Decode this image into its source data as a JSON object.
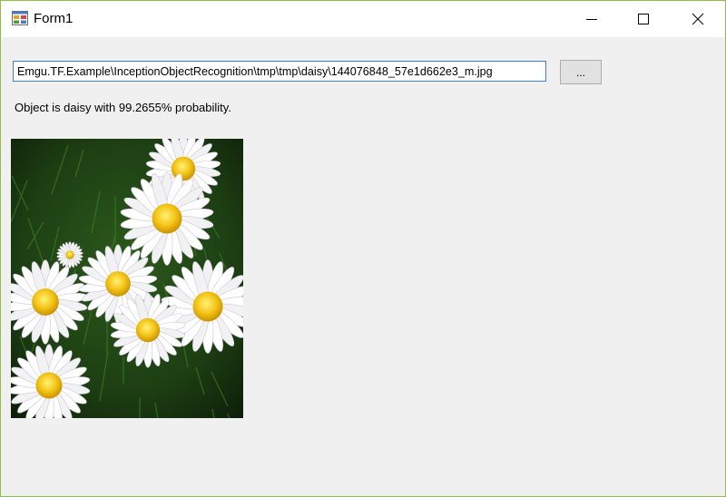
{
  "window": {
    "title": "Form1"
  },
  "form": {
    "file_path": "Emgu.TF.Example\\InceptionObjectRecognition\\tmp\\tmp\\daisy\\144076848_57e1d662e3_m.jpg",
    "browse_label": "...",
    "result_text": "Object is daisy with 99.2655% probability."
  },
  "colors": {
    "window_border": "#8fbf4a",
    "titlebar": "#ffffff",
    "form_background": "#f0f0f0",
    "input_focus_border": "#3c7fd4",
    "button_face": "#e1e1e1"
  },
  "icons": {
    "app": "form-app-icon",
    "minimize": "minimize-icon",
    "maximize": "maximize-icon",
    "close": "close-icon"
  }
}
